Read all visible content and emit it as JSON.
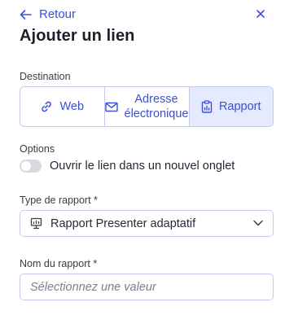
{
  "header": {
    "back_label": "Retour",
    "title": "Ajouter un lien"
  },
  "destination": {
    "label": "Destination",
    "options": [
      {
        "label": "Web",
        "icon": "link-icon"
      },
      {
        "label": "Adresse électronique",
        "icon": "envelope-icon"
      },
      {
        "label": "Rapport",
        "icon": "report-icon",
        "selected": true
      }
    ]
  },
  "options": {
    "label": "Options",
    "toggle_label": "Ouvrir le lien dans un nouvel onglet",
    "toggle_on": false
  },
  "report_type": {
    "label": "Type de rapport *",
    "value": "Rapport Presenter adaptatif",
    "icon": "presenter-icon"
  },
  "report_name": {
    "label": "Nom du rapport *",
    "placeholder": "Sélectionnez une valeur",
    "value": ""
  },
  "colors": {
    "accent": "#3b4fd8",
    "selected_bg": "#e6eaff",
    "border": "#c7ccee"
  }
}
